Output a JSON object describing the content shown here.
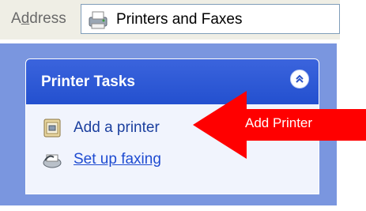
{
  "address_bar": {
    "label_prefix": "A",
    "label_underlined": "d",
    "label_suffix": "dress",
    "value": "Printers and Faxes",
    "icon": "printer-fax-icon"
  },
  "printer_tasks": {
    "title": "Printer Tasks",
    "collapse_icon": "double-chevron-up-icon",
    "items": [
      {
        "label": "Add a printer",
        "icon": "add-printer-icon"
      },
      {
        "label": "Set up faxing",
        "icon": "fax-icon"
      }
    ]
  },
  "annotation": {
    "label": "Add Printer",
    "color": "#ff0000"
  }
}
